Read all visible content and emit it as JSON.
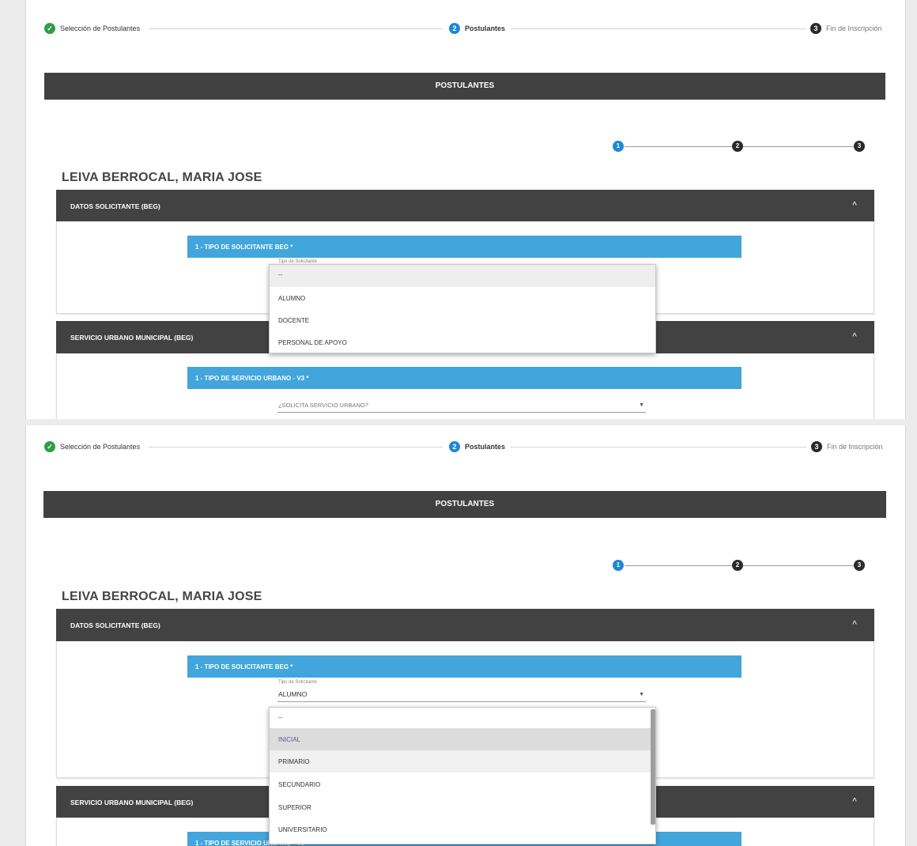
{
  "wizard": {
    "steps": [
      {
        "label": "Selección de Postulantes",
        "icon": "check-icon",
        "number": "",
        "color": "#2e9e47"
      },
      {
        "label": "Postulantes",
        "icon": "",
        "number": "2",
        "color": "#1e88d6"
      },
      {
        "label": "Fin de Inscripción",
        "icon": "",
        "number": "3",
        "color": "#2b2b2b"
      }
    ]
  },
  "page_title": "POSTULANTES",
  "sub_steps": [
    "1",
    "2",
    "3"
  ],
  "colors": {
    "active_step": "#1e88d6",
    "header": "#414141",
    "question_bar": "#42a5dc"
  },
  "applicant_name": "LEIVA BERROCAL, MARIA JOSE",
  "sections": {
    "datos": {
      "title": "DATOS SOLICITANTE (BEG)",
      "question": "1 - TIPO DE SOLICITANTE BEG *",
      "select_label": "Tipo de Solicitante",
      "select_value": "ALUMNO"
    },
    "servicio": {
      "title": "SERVICIO URBANO MUNICIPAL (BEG)",
      "question": "1 - TIPO DE SERVICIO URBANO - V3 *",
      "select_placeholder": "¿SOLICITA SERVICIO URBANO?"
    }
  },
  "dropdown_tipo": {
    "options": [
      "--",
      "ALUMNO",
      "DOCENTE",
      "PERSONAL DE APOYO"
    ]
  },
  "dropdown_nivel": {
    "options": [
      "--",
      "INICIAL",
      "PRIMARIO",
      "SECUNDARIO",
      "SUPERIOR",
      "UNIVERSITARIO"
    ]
  }
}
